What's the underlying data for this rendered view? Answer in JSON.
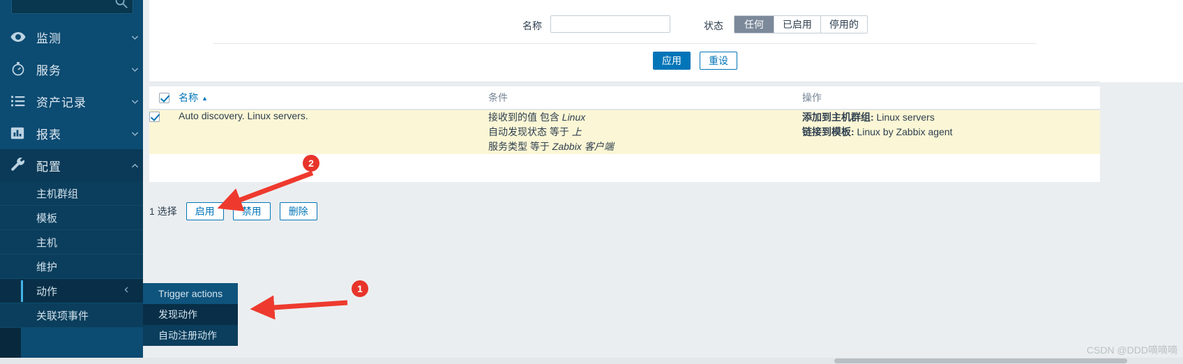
{
  "sidebar": {
    "search": {
      "value": "",
      "placeholder": "",
      "icon": "search-icon"
    },
    "nav": [
      {
        "label": "监测",
        "icon": "eye-icon",
        "chevron": "chevron-down",
        "active": false
      },
      {
        "label": "服务",
        "icon": "stopwatch-icon",
        "chevron": "chevron-down",
        "active": false
      },
      {
        "label": "资产记录",
        "icon": "list-icon",
        "chevron": "chevron-down",
        "active": false
      },
      {
        "label": "报表",
        "icon": "bar-chart-icon",
        "chevron": "chevron-down",
        "active": false
      },
      {
        "label": "配置",
        "icon": "wrench-icon",
        "chevron": "chevron-up",
        "active": true
      }
    ],
    "subnav": [
      {
        "label": "主机群组",
        "selected": false
      },
      {
        "label": "模板",
        "selected": false
      },
      {
        "label": "主机",
        "selected": false
      },
      {
        "label": "维护",
        "selected": false
      },
      {
        "label": "动作",
        "selected": true,
        "chevron": "chevron-left"
      },
      {
        "label": "关联项事件",
        "selected": false
      }
    ]
  },
  "flyout": {
    "items": [
      {
        "label": "Trigger actions",
        "state": "hover"
      },
      {
        "label": "发现动作",
        "state": "current"
      },
      {
        "label": "自动注册动作",
        "state": "normal"
      }
    ]
  },
  "filter": {
    "name_label": "名称",
    "name_value": "",
    "name_placeholder": "",
    "state_label": "状态",
    "state_options": [
      {
        "label": "任何",
        "selected": true
      },
      {
        "label": "已启用",
        "selected": false
      },
      {
        "label": "停用的",
        "selected": false
      }
    ],
    "apply_label": "应用",
    "reset_label": "重设"
  },
  "table": {
    "headers": {
      "name": "名称",
      "sort_arrow": "▲",
      "condition": "条件",
      "operation": "操作"
    },
    "header_checkbox_checked": true,
    "rows": [
      {
        "checked": true,
        "name": "Auto discovery. Linux servers.",
        "conditions": [
          {
            "prefix": "接收到的值 包含 ",
            "value": "Linux"
          },
          {
            "prefix": "自动发现状态 等于 ",
            "value": "上"
          },
          {
            "prefix": "服务类型 等于 ",
            "value": "Zabbix 客户端"
          }
        ],
        "operations": [
          {
            "label": "添加到主机群组:",
            "value": " Linux servers"
          },
          {
            "label": "链接到模板:",
            "value": " Linux by Zabbix agent"
          }
        ]
      }
    ]
  },
  "footer": {
    "selected_text": "1 选择",
    "buttons": [
      {
        "label": "启用"
      },
      {
        "label": "禁用"
      },
      {
        "label": "删除"
      }
    ]
  },
  "annotations": [
    {
      "id": "1",
      "number": "1"
    },
    {
      "id": "2",
      "number": "2"
    }
  ],
  "watermark": "CSDN @DDD嘀嘀嘀",
  "colors": {
    "sidebar_bg": "#0c4b72",
    "sidebar_sub_bg": "#0b3e5c",
    "accent_blue": "#0275b8",
    "row_highlight": "#fbf6d5",
    "annotation_red": "#e8342a",
    "segment_active": "#7c899a"
  }
}
